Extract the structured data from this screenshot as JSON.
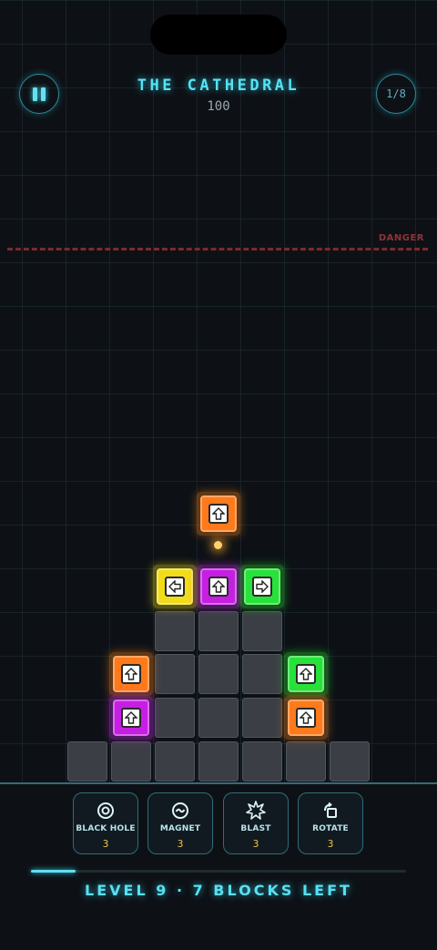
{
  "header": {
    "title": "THE CATHEDRAL",
    "score": "100",
    "level_indicator": "1/8",
    "pause_icon": "pause-icon"
  },
  "board": {
    "danger_label": "DANGER",
    "blocks": [
      {
        "color": "orange",
        "arrow": "up"
      },
      {
        "color": "yellow",
        "arrow": "left"
      },
      {
        "color": "purple",
        "arrow": "up"
      },
      {
        "color": "green",
        "arrow": "right"
      },
      {
        "color": "orange",
        "arrow": "up"
      },
      {
        "color": "purple",
        "arrow": "up"
      },
      {
        "color": "green",
        "arrow": "up"
      },
      {
        "color": "orange",
        "arrow": "up"
      }
    ]
  },
  "powerups": [
    {
      "label": "BLACK HOLE",
      "count": "3",
      "icon": "black-hole-icon"
    },
    {
      "label": "MAGNET",
      "count": "3",
      "icon": "magnet-icon"
    },
    {
      "label": "BLAST",
      "count": "3",
      "icon": "blast-icon"
    },
    {
      "label": "ROTATE",
      "count": "3",
      "icon": "rotate-icon"
    }
  ],
  "progress": 0.12,
  "footer": {
    "status": "LEVEL 9 · 7 BLOCKS LEFT"
  },
  "colors": {
    "accent": "#55e3f5",
    "orange": "#ff7a1a",
    "purple": "#c61fe3",
    "yellow": "#f2dc1a",
    "green": "#27e23a",
    "danger": "#8f3339",
    "count": "#f0c24a"
  }
}
